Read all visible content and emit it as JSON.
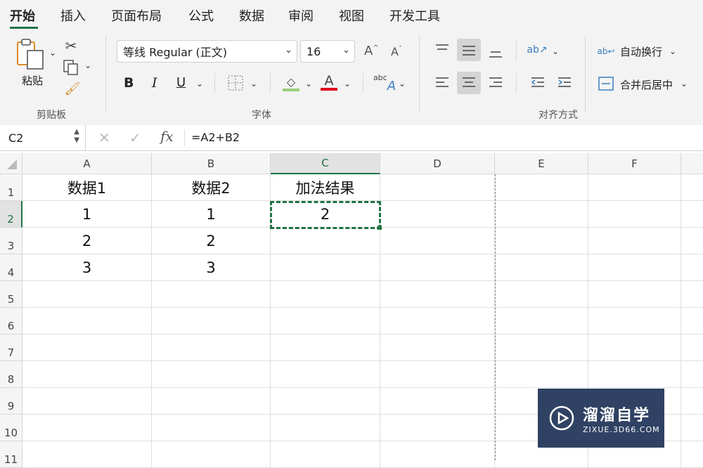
{
  "tabs": [
    "开始",
    "插入",
    "页面布局",
    "公式",
    "数据",
    "审阅",
    "视图",
    "开发工具"
  ],
  "ribbon": {
    "clipboard": {
      "group_label": "剪贴板",
      "paste_label": "粘贴"
    },
    "font": {
      "group_label": "字体",
      "font_name": "等线 Regular (正文)",
      "font_size": "16",
      "bold": "B",
      "italic": "I",
      "underline": "U",
      "grow": "A",
      "shrink": "A",
      "font_color": "A",
      "phonetic": "abc"
    },
    "alignment": {
      "group_label": "对齐方式",
      "wrap_text": "自动换行",
      "merge_center": "合并后居中"
    }
  },
  "formula_bar": {
    "name_box": "C2",
    "fx": "fx",
    "formula": "=A2+B2"
  },
  "grid": {
    "columns": [
      "A",
      "B",
      "C",
      "D",
      "E",
      "F"
    ],
    "rows": [
      "1",
      "2",
      "3",
      "4",
      "5",
      "6",
      "7",
      "8",
      "9",
      "10",
      "11"
    ],
    "cells": [
      [
        "数据1",
        "数据2",
        "加法结果",
        "",
        "",
        ""
      ],
      [
        "1",
        "1",
        "2",
        "",
        "",
        ""
      ],
      [
        "2",
        "2",
        "",
        "",
        "",
        ""
      ],
      [
        "3",
        "3",
        "",
        "",
        "",
        ""
      ]
    ],
    "selected_cell": "C2"
  },
  "watermark": {
    "title": "溜溜自学",
    "url": "ZIXUE.3D66.COM"
  },
  "colors": {
    "accent": "#217346",
    "font_color_bar": "#e0001b",
    "fill_color_bar": "#9bd07a"
  }
}
